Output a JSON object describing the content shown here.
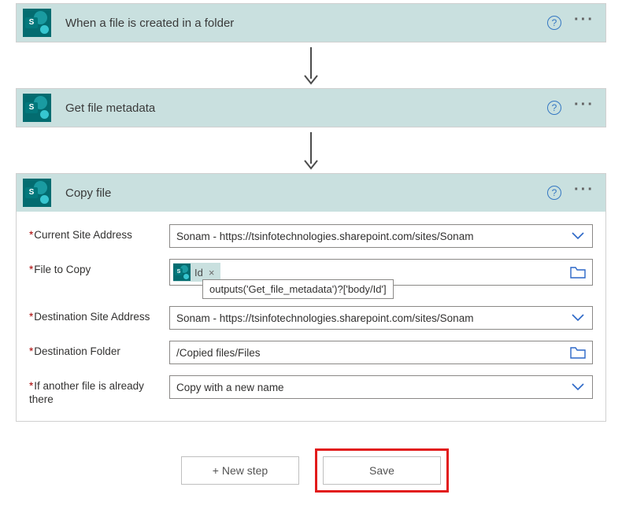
{
  "colors": {
    "header_bg": "#c9e0df",
    "brand": "#036c70",
    "accent": "#2b67c7",
    "highlight": "#e21b1b",
    "required": "#a80000"
  },
  "steps": [
    {
      "title": "When a file is created in a folder"
    },
    {
      "title": "Get file metadata"
    },
    {
      "title": "Copy file"
    }
  ],
  "copy_file": {
    "labels": {
      "current_site": "Current Site Address",
      "file_to_copy": "File to Copy",
      "dest_site": "Destination Site Address",
      "dest_folder": "Destination Folder",
      "if_exists": "If another file is already there"
    },
    "values": {
      "current_site": "Sonam - https://tsinfotechnologies.sharepoint.com/sites/Sonam",
      "file_token_label": "Id",
      "file_token_tooltip": "outputs('Get_file_metadata')?['body/Id']",
      "dest_site": "Sonam - https://tsinfotechnologies.sharepoint.com/sites/Sonam",
      "dest_folder": "/Copied files/Files",
      "if_exists": "Copy with a new name"
    }
  },
  "buttons": {
    "new_step": "+ New step",
    "save": "Save"
  }
}
